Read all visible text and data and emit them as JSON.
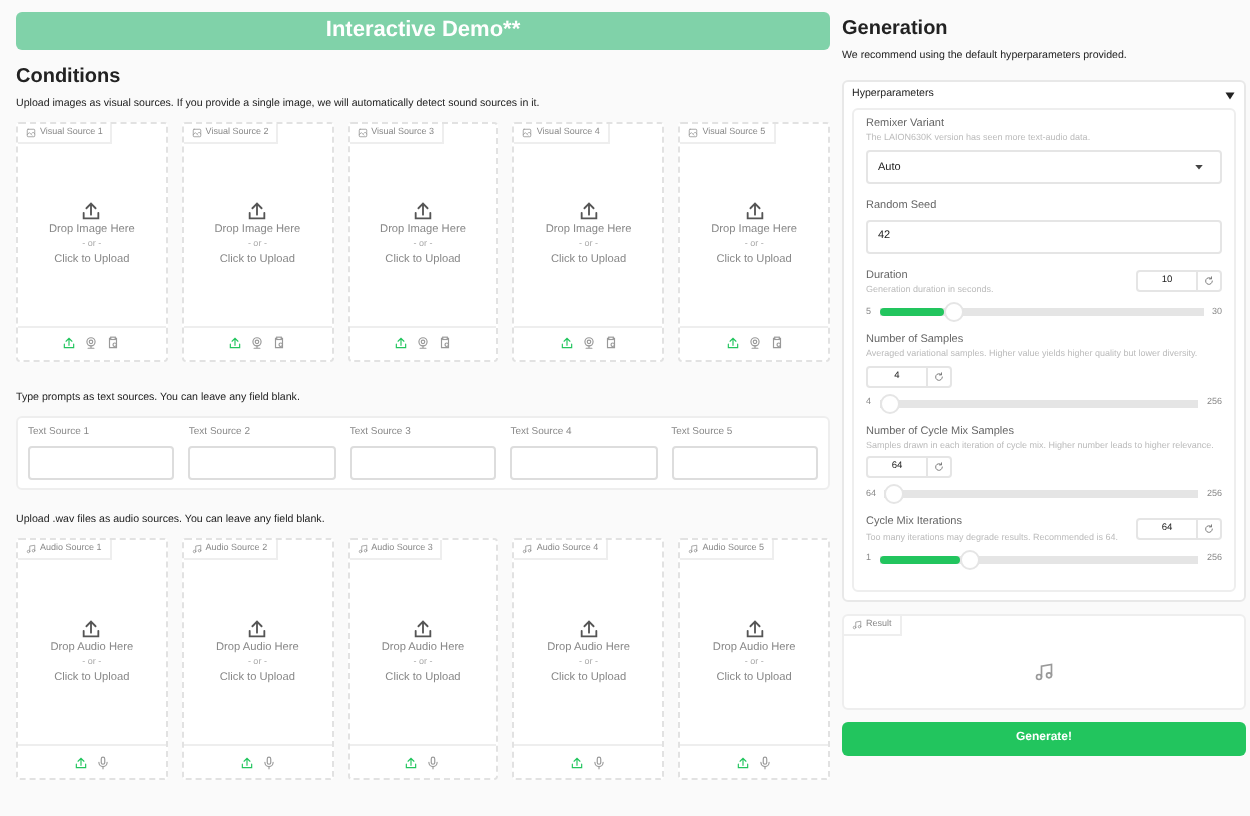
{
  "header": {
    "title": "Interactive Demo**"
  },
  "conditions": {
    "title": "Conditions",
    "image_hint": "Upload images as visual sources. If you provide a single image, we will automatically detect sound sources in it.",
    "image_sources": [
      {
        "label": "Visual Source 1",
        "drop": "Drop Image Here",
        "or": "- or -",
        "click": "Click to Upload"
      },
      {
        "label": "Visual Source 2",
        "drop": "Drop Image Here",
        "or": "- or -",
        "click": "Click to Upload"
      },
      {
        "label": "Visual Source 3",
        "drop": "Drop Image Here",
        "or": "- or -",
        "click": "Click to Upload"
      },
      {
        "label": "Visual Source 4",
        "drop": "Drop Image Here",
        "or": "- or -",
        "click": "Click to Upload"
      },
      {
        "label": "Visual Source 5",
        "drop": "Drop Image Here",
        "or": "- or -",
        "click": "Click to Upload"
      }
    ],
    "text_hint": "Type prompts as text sources. You can leave any field blank.",
    "text_sources": [
      {
        "label": "Text Source 1"
      },
      {
        "label": "Text Source 2"
      },
      {
        "label": "Text Source 3"
      },
      {
        "label": "Text Source 4"
      },
      {
        "label": "Text Source 5"
      }
    ],
    "audio_hint": "Upload .wav files as audio sources. You can leave any field blank.",
    "audio_sources": [
      {
        "label": "Audio Source 1",
        "drop": "Drop Audio Here",
        "or": "- or -",
        "click": "Click to Upload"
      },
      {
        "label": "Audio Source 2",
        "drop": "Drop Audio Here",
        "or": "- or -",
        "click": "Click to Upload"
      },
      {
        "label": "Audio Source 3",
        "drop": "Drop Audio Here",
        "or": "- or -",
        "click": "Click to Upload"
      },
      {
        "label": "Audio Source 4",
        "drop": "Drop Audio Here",
        "or": "- or -",
        "click": "Click to Upload"
      },
      {
        "label": "Audio Source 5",
        "drop": "Drop Audio Here",
        "or": "- or -",
        "click": "Click to Upload"
      }
    ]
  },
  "generation": {
    "title": "Generation",
    "note": "We recommend using the default hyperparameters provided.",
    "hyperparameters": {
      "title": "Hyperparameters",
      "expanded": true,
      "remixer": {
        "label": "Remixer Variant",
        "info": "The LAION630K version has seen more text-audio data.",
        "value": "Auto"
      },
      "seed": {
        "label": "Random Seed",
        "value": "42"
      },
      "sliders": [
        {
          "kind": "inline",
          "label": "Duration",
          "info": "Generation duration in seconds.",
          "value": "10",
          "min": "5",
          "max": "30",
          "level": 0.2
        },
        {
          "kind": "stacked",
          "label": "Number of Samples",
          "info": "Averaged variational samples. Higher value yields higher quality but lower diversity.",
          "value": "4",
          "min": "4",
          "max": "256",
          "level": 0
        },
        {
          "kind": "stacked",
          "label": "Number of Cycle Mix Samples",
          "info": "Samples drawn in each iteration of cycle mix. Higher number leads to higher relevance.",
          "value": "64",
          "min": "64",
          "max": "256",
          "level": 0
        },
        {
          "kind": "inline",
          "label": "Cycle Mix Iterations",
          "info": "Too many iterations may degrade results. Recommended is 64.",
          "value": "64",
          "min": "1",
          "max": "256",
          "level": 0.25
        }
      ]
    },
    "result": {
      "label": "Result"
    },
    "generate_button": "Generate!"
  }
}
